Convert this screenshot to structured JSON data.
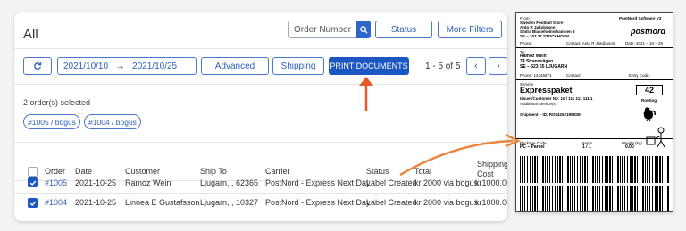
{
  "header": {
    "title": "All",
    "search_placeholder": "Order Number",
    "status_label": "Status",
    "more_filters_label": "More Filters"
  },
  "toolbar": {
    "date_from": "2021/10/10",
    "date_arrow": "→",
    "date_to": "2021/10/25",
    "advanced_label": "Advanced",
    "shipping_label": "Shipping",
    "print_label": "PRINT DOCUMENTS",
    "pager_text": "1 - 5 of 5",
    "prev_label": "‹",
    "next_label": "›"
  },
  "selection": {
    "summary": "2 order(s) selected",
    "chips": [
      "#1005 / bogus",
      "#1004 / bogus"
    ]
  },
  "table": {
    "columns": [
      "Order",
      "Date",
      "Customer",
      "Ship To",
      "Carrier",
      "Status",
      "Total",
      "Shipping Cost"
    ],
    "rows": [
      {
        "order": "#1005",
        "date": "2021-10-25",
        "customer": "Ramoz Wein",
        "ship_to": "Ljugarn, , 62365",
        "carrier": "PostNord - Express Next Day",
        "status": "Label Created",
        "total": "kr 2000 via bogus",
        "shipping_cost": "kr1000.00"
      },
      {
        "order": "#1004",
        "date": "2021-10-25",
        "customer": "Linnea E Gustafsson",
        "ship_to": "Ljugarn, , 10327",
        "carrier": "PostNord - Express Next Day",
        "status": "Label Created",
        "total": "kr 2000 via bogus",
        "shipping_cost": "kr1000.00"
      }
    ]
  },
  "label": {
    "from_tag": "From:",
    "software": "PostNord Software V3",
    "sender_lines": [
      "Sweden Football Store",
      "Anto R Jakobsson",
      "Södra Blasieholmshamnen 8",
      "SE – 103 27 STOCKHOLM"
    ],
    "brand": "postnord",
    "phone_line": "Phone:",
    "contact_line": "Contact: Anto R Jakobsson",
    "date_line": "Date: 2021 – 10 – 25",
    "to_tag": "To:",
    "receiver_lines": [
      "Ramoz Wein",
      "74 Strandvägen",
      "SE – 623 65 LJUGARN"
    ],
    "phone2_line": "Phone: 12345671",
    "contact2_line": "Contact:",
    "entry_line": "Entry Code:",
    "service_tag": "Service",
    "service_name": "Expresspaket",
    "routing_number": "42",
    "routing_label": "Routing",
    "issuer_line": "Issuer/Customer No:   10 / 111 111 111 1",
    "added_services": "Additional Service(s)",
    "shipment_line": "Shipment – ID:     RO342521908SE",
    "package_code_tag": "Package Code",
    "package_code": "PC – Parcel",
    "items_tag": "Items",
    "items_value": "1 / 1",
    "weight_tag": "Weight (kg)",
    "weight_value": "0.00"
  },
  "colors": {
    "accent": "#1b56c2",
    "arrow": "#e8582a",
    "curve": "#e9863f"
  }
}
